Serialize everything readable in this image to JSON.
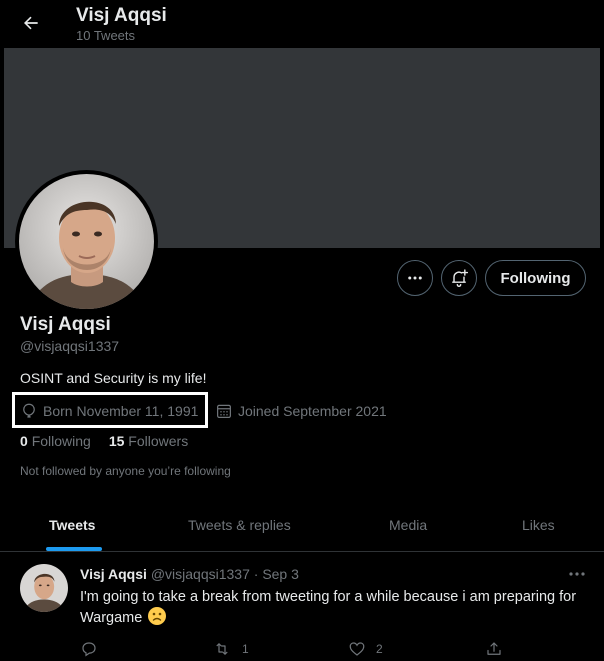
{
  "header": {
    "title": "Visj Aqqsi",
    "tweet_count": "10 Tweets"
  },
  "profile": {
    "name": "Visj Aqqsi",
    "handle": "@visjaqqsi1337",
    "bio": "OSINT and Security is my life!",
    "born": "Born November 11, 1991",
    "joined": "Joined September 2021",
    "following_count": "0",
    "following_label": "Following",
    "followers_count": "15",
    "followers_label": "Followers",
    "not_followed": "Not followed by anyone you’re following",
    "follow_button_label": "Following"
  },
  "tabs": [
    {
      "label": "Tweets",
      "active": true
    },
    {
      "label": "Tweets & replies",
      "active": false
    },
    {
      "label": "Media",
      "active": false
    },
    {
      "label": "Likes",
      "active": false
    }
  ],
  "tweet": {
    "author": "Visj Aqqsi",
    "handle": "@visjaqqsi1337",
    "separator": "·",
    "date": "Sep 3",
    "text": "I'm going to take a break from tweeting for a while because i am preparing for Wargame",
    "emoji": "frowning-face",
    "retweets": "1",
    "likes": "2"
  },
  "colors": {
    "accent": "#1d9bf0",
    "banner": "#333639",
    "muted": "#71767b"
  }
}
